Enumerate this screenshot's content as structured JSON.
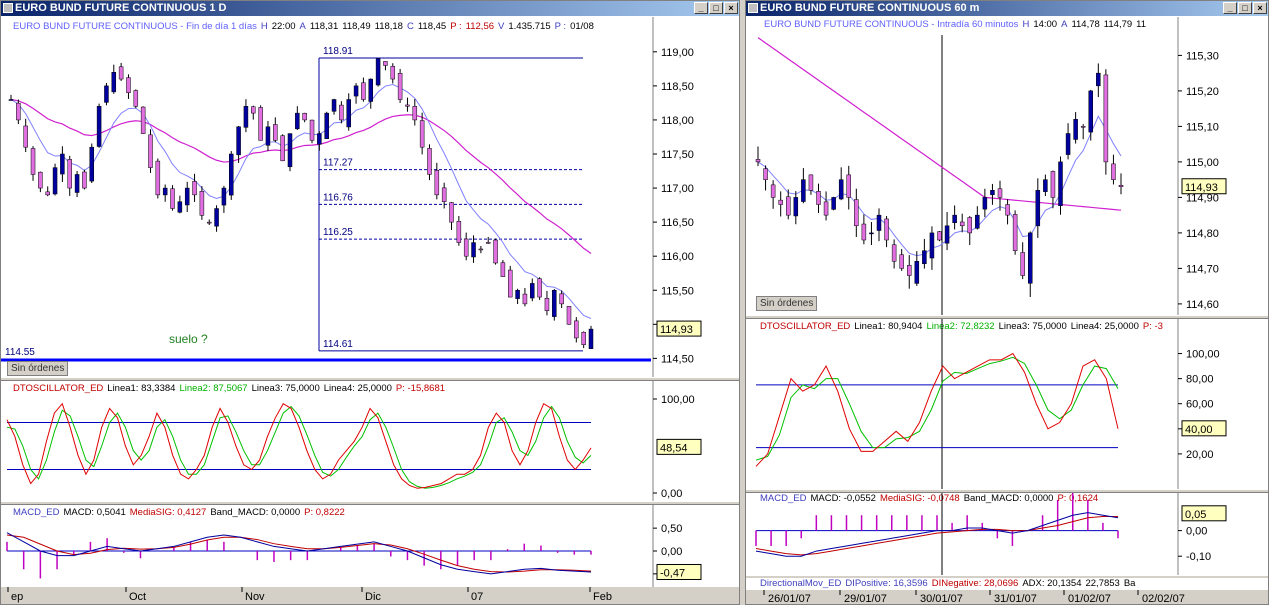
{
  "left": {
    "title": "EURO BUND FUTURE CONTINUOUS 1 D",
    "info": [
      "EURO BUND FUTURE CONTINUOUS - Fin de día 1 días",
      "H",
      "22:00",
      "A",
      "118,31",
      "118,49",
      "118,18",
      "C",
      "118,45",
      "P :",
      "112,56",
      "V",
      "1.435.715",
      "P :",
      "01/08"
    ],
    "price_ticks": [
      "119,00",
      "118,50",
      "118,00",
      "117,50",
      "117,00",
      "116,50",
      "116,00",
      "115,50",
      "115,00",
      "114,50"
    ],
    "last_price": "114,93",
    "fib_levels": [
      "118.91",
      "117.27",
      "116.76",
      "116.25",
      "114.61"
    ],
    "support_label": "114.55",
    "annotation": "suelo ?",
    "no_orders": "Sin órdenes",
    "osc_info": [
      "DTOSCILLATOR_ED",
      "Linea1: 83,3384",
      "Linea2: 87,5067",
      "Linea3: 75,0000",
      "Linea4: 25,0000",
      "P: -15,8681"
    ],
    "osc_ticks": [
      "100,00",
      "0,00"
    ],
    "osc_last": "48,54",
    "macd_info": [
      "MACD_ED",
      "MACD: 0,5041",
      "MediaSIG: 0,4127",
      "Band_MACD: 0,0000",
      "P: 0,8222"
    ],
    "macd_ticks": [
      "0,50",
      "0,00",
      "-0,50"
    ],
    "macd_last": "-0,47",
    "x_labels": [
      "ep",
      "Oct",
      "Nov",
      "Dic",
      "07",
      "Feb"
    ]
  },
  "right": {
    "title": "EURO BUND FUTURE CONTINUOUS 60 m",
    "info": [
      "EURO BUND FUTURE CONTINUOUS - Intradía 60 minutos",
      "H",
      "14:00",
      "A",
      "114,78",
      "114,79",
      "11"
    ],
    "price_ticks": [
      "115,30",
      "115,20",
      "115,10",
      "115,00",
      "114,90",
      "114,80",
      "114,70",
      "114,60"
    ],
    "last_price": "114,93",
    "no_orders": "Sin órdenes",
    "osc_info": [
      "DTOSCILLATOR_ED",
      "Linea1: 80,9404",
      "Linea2: 72,8232",
      "Linea3: 75,0000",
      "Linea4: 25,0000",
      "P: -3"
    ],
    "osc_ticks": [
      "100,00",
      "80,00",
      "60,00",
      "40,00",
      "20,00"
    ],
    "osc_last": "40,00",
    "macd_info": [
      "MACD_ED",
      "MACD: -0,0552",
      "MediaSIG: -0,0748",
      "Band_MACD: 0,0000",
      "P: 0,1624"
    ],
    "macd_ticks": [
      "0,00",
      "-0,10"
    ],
    "macd_last": "0,05",
    "dmi_info": [
      "DirectionalMov_ED",
      "DIPositive: 16,3596",
      "DINegative: 28,0696",
      "ADX: 20,1354",
      "22,7853",
      "Ba"
    ],
    "x_labels": [
      "26/01/07",
      "29/01/07",
      "30/01/07",
      "31/01/07",
      "01/02/07",
      "02/02/07"
    ]
  },
  "colors": {
    "up": "#0000a0",
    "down": "#e070e0",
    "ma_fast": "#8080ff",
    "ma_slow": "#d020d0",
    "osc1": "#e00000",
    "osc2": "#00c000",
    "level": "#0000c0",
    "support": "#0000ff",
    "macd": "#0000a0",
    "signal": "#c00000",
    "hist": "#c000c0"
  },
  "chart_data": [
    {
      "type": "candlestick",
      "title": "EURO BUND FUTURE CONTINUOUS 1 D",
      "x_labels": [
        "Sep",
        "Oct",
        "Nov",
        "Dic",
        "07",
        "Feb"
      ],
      "ylim": [
        114.3,
        119.1
      ],
      "closes": [
        118.3,
        118.0,
        117.6,
        117.2,
        117.0,
        116.9,
        117.3,
        117.5,
        117.0,
        117.2,
        117.0,
        117.6,
        118.2,
        118.5,
        118.7,
        118.6,
        118.4,
        118.2,
        117.8,
        117.3,
        116.9,
        117.0,
        116.7,
        116.8,
        117.0,
        116.9,
        116.6,
        116.5,
        116.7,
        117.0,
        117.5,
        117.9,
        118.2,
        118.1,
        117.7,
        117.9,
        117.7,
        117.4,
        117.8,
        118.1,
        118.0,
        117.7,
        117.8,
        118.1,
        118.3,
        118.0,
        118.3,
        118.5,
        118.3,
        118.6,
        118.9,
        118.8,
        118.6,
        118.3,
        118.2,
        118.0,
        117.6,
        117.2,
        116.9,
        116.8,
        116.5,
        116.2,
        116.0,
        116.2,
        116.1,
        116.2,
        115.9,
        115.7,
        115.4,
        115.5,
        115.3,
        115.6,
        115.4,
        115.2,
        115.5,
        115.3,
        115.0,
        114.8,
        114.7,
        114.93
      ],
      "support": 114.55,
      "fib_levels": [
        118.91,
        117.27,
        116.76,
        116.25,
        114.61
      ]
    },
    {
      "type": "line",
      "title": "DTOSCILLATOR_ED",
      "ylim": [
        0,
        100
      ],
      "levels": [
        75,
        25
      ],
      "series": [
        {
          "name": "Linea1",
          "values": [
            78,
            60,
            30,
            10,
            20,
            55,
            85,
            95,
            70,
            40,
            20,
            35,
            70,
            90,
            80,
            50,
            30,
            40,
            60,
            85,
            70,
            40,
            20,
            15,
            25,
            40,
            70,
            90,
            75,
            50,
            30,
            25,
            35,
            60,
            80,
            95,
            90,
            70,
            45,
            25,
            15,
            20,
            35,
            45,
            55,
            70,
            90,
            80,
            55,
            30,
            15,
            8,
            5,
            6,
            8,
            10,
            15,
            20,
            20,
            25,
            40,
            70,
            85,
            75,
            45,
            30,
            45,
            75,
            95,
            90,
            60,
            35,
            25,
            35,
            48
          ]
        },
        {
          "name": "Linea2",
          "values": [
            70,
            68,
            50,
            25,
            15,
            35,
            65,
            88,
            82,
            60,
            35,
            28,
            50,
            75,
            85,
            70,
            45,
            35,
            45,
            70,
            78,
            60,
            35,
            20,
            20,
            30,
            55,
            80,
            82,
            65,
            45,
            30,
            30,
            45,
            65,
            85,
            92,
            82,
            62,
            40,
            22,
            18,
            25,
            38,
            50,
            60,
            78,
            85,
            70,
            48,
            25,
            12,
            7,
            5,
            6,
            8,
            11,
            15,
            18,
            22,
            30,
            50,
            75,
            80,
            65,
            45,
            40,
            55,
            80,
            92,
            80,
            55,
            38,
            32,
            40
          ]
        }
      ]
    },
    {
      "type": "bar",
      "title": "MACD_ED",
      "ylim": [
        -0.7,
        0.7
      ],
      "series": [
        {
          "name": "MACD",
          "values": [
            0.4,
            0.2,
            0.0,
            -0.1,
            -0.1,
            0.0,
            0.1,
            0.05,
            0.0,
            0.05,
            0.1,
            0.2,
            0.3,
            0.35,
            0.3,
            0.2,
            0.1,
            0.05,
            0.0,
            0.05,
            0.1,
            0.15,
            0.2,
            0.1,
            0.0,
            -0.15,
            -0.3,
            -0.4,
            -0.45,
            -0.5,
            -0.45,
            -0.4,
            -0.38,
            -0.42,
            -0.44,
            -0.46
          ]
        },
        {
          "name": "MediaSIG",
          "values": [
            0.35,
            0.3,
            0.15,
            0.0,
            -0.08,
            -0.05,
            0.03,
            0.06,
            0.04,
            0.05,
            0.08,
            0.15,
            0.24,
            0.3,
            0.3,
            0.25,
            0.16,
            0.1,
            0.05,
            0.05,
            0.08,
            0.12,
            0.16,
            0.13,
            0.05,
            -0.07,
            -0.2,
            -0.32,
            -0.4,
            -0.45,
            -0.46,
            -0.44,
            -0.41,
            -0.41,
            -0.42,
            -0.44
          ]
        }
      ]
    },
    {
      "type": "candlestick",
      "title": "EURO BUND FUTURE CONTINUOUS 60 m",
      "x_labels": [
        "26/01/07",
        "29/01/07",
        "30/01/07",
        "31/01/07",
        "01/02/07",
        "02/02/07"
      ],
      "ylim": [
        114.58,
        115.38
      ],
      "closes": [
        115.0,
        114.95,
        114.9,
        114.88,
        114.85,
        114.9,
        114.95,
        114.92,
        114.88,
        114.85,
        114.9,
        114.95,
        114.9,
        114.82,
        114.78,
        114.8,
        114.85,
        114.78,
        114.72,
        114.7,
        114.68,
        114.72,
        114.75,
        114.8,
        114.78,
        114.82,
        114.85,
        114.82,
        114.8,
        114.85,
        114.9,
        114.92,
        114.9,
        114.85,
        114.75,
        114.68,
        114.8,
        114.92,
        114.95,
        114.9,
        115.0,
        115.08,
        115.12,
        115.1,
        115.2,
        115.25,
        115.0,
        114.95,
        114.93
      ]
    },
    {
      "type": "line",
      "title": "DTOSCILLATOR_ED",
      "ylim": [
        0,
        100
      ],
      "levels": [
        75,
        25
      ],
      "series": [
        {
          "name": "Linea1",
          "values": [
            10,
            20,
            50,
            80,
            70,
            75,
            90,
            70,
            40,
            22,
            22,
            30,
            38,
            30,
            45,
            70,
            90,
            80,
            85,
            90,
            95,
            95,
            100,
            85,
            60,
            40,
            45,
            60,
            90,
            95,
            80,
            40
          ]
        },
        {
          "name": "Linea2",
          "values": [
            15,
            18,
            35,
            65,
            75,
            72,
            80,
            80,
            60,
            38,
            25,
            25,
            32,
            33,
            38,
            55,
            78,
            85,
            84,
            88,
            92,
            94,
            97,
            92,
            75,
            55,
            48,
            55,
            75,
            90,
            88,
            72
          ]
        }
      ]
    },
    {
      "type": "bar",
      "title": "MACD_ED",
      "ylim": [
        -0.15,
        0.1
      ],
      "series": [
        {
          "name": "MACD",
          "values": [
            -0.08,
            -0.09,
            -0.1,
            -0.1,
            -0.08,
            -0.07,
            -0.06,
            -0.05,
            -0.04,
            -0.03,
            -0.02,
            -0.01,
            0.0,
            0.0,
            0.01,
            0.01,
            0.0,
            -0.01,
            0.0,
            0.02,
            0.04,
            0.06,
            0.07,
            0.06,
            0.05
          ]
        },
        {
          "name": "MediaSIG",
          "values": [
            -0.07,
            -0.08,
            -0.09,
            -0.095,
            -0.09,
            -0.08,
            -0.07,
            -0.06,
            -0.05,
            -0.04,
            -0.03,
            -0.02,
            -0.01,
            -0.005,
            0.0,
            0.005,
            0.005,
            0.0,
            0.0,
            0.01,
            0.02,
            0.035,
            0.05,
            0.055,
            0.055
          ]
        }
      ]
    }
  ]
}
